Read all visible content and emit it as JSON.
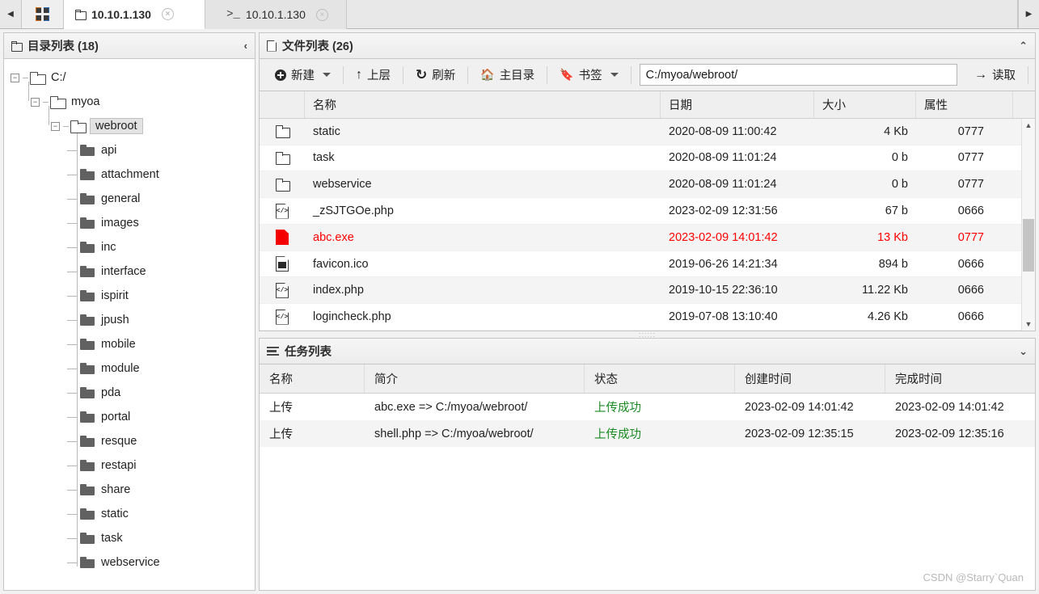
{
  "tabbar": {
    "nav_left_icon": "chevron-left-icon",
    "nav_right_icon": "chevron-right-icon",
    "apps_icon": "grid-apps-icon",
    "tabs": [
      {
        "label": "10.10.1.130",
        "icon": "folder-icon",
        "close": "×",
        "active": true
      },
      {
        "label": "10.10.1.130",
        "icon": "terminal-icon",
        "close": "×",
        "active": false
      }
    ]
  },
  "left_panel": {
    "title": "目录列表 (18)",
    "collapse_icon": "‹",
    "tree": [
      {
        "label": "C:/",
        "depth": 0,
        "expanded": true,
        "selected": false
      },
      {
        "label": "myoa",
        "depth": 1,
        "expanded": true,
        "selected": false
      },
      {
        "label": "webroot",
        "depth": 2,
        "expanded": true,
        "selected": true
      },
      {
        "label": "api",
        "depth": 3,
        "expanded": null,
        "selected": false
      },
      {
        "label": "attachment",
        "depth": 3,
        "expanded": null,
        "selected": false
      },
      {
        "label": "general",
        "depth": 3,
        "expanded": null,
        "selected": false
      },
      {
        "label": "images",
        "depth": 3,
        "expanded": null,
        "selected": false
      },
      {
        "label": "inc",
        "depth": 3,
        "expanded": null,
        "selected": false
      },
      {
        "label": "interface",
        "depth": 3,
        "expanded": null,
        "selected": false
      },
      {
        "label": "ispirit",
        "depth": 3,
        "expanded": null,
        "selected": false
      },
      {
        "label": "jpush",
        "depth": 3,
        "expanded": null,
        "selected": false
      },
      {
        "label": "mobile",
        "depth": 3,
        "expanded": null,
        "selected": false
      },
      {
        "label": "module",
        "depth": 3,
        "expanded": null,
        "selected": false
      },
      {
        "label": "pda",
        "depth": 3,
        "expanded": null,
        "selected": false
      },
      {
        "label": "portal",
        "depth": 3,
        "expanded": null,
        "selected": false
      },
      {
        "label": "resque",
        "depth": 3,
        "expanded": null,
        "selected": false
      },
      {
        "label": "restapi",
        "depth": 3,
        "expanded": null,
        "selected": false
      },
      {
        "label": "share",
        "depth": 3,
        "expanded": null,
        "selected": false
      },
      {
        "label": "static",
        "depth": 3,
        "expanded": null,
        "selected": false
      },
      {
        "label": "task",
        "depth": 3,
        "expanded": null,
        "selected": false
      },
      {
        "label": "webservice",
        "depth": 3,
        "expanded": null,
        "selected": false
      }
    ]
  },
  "file_panel": {
    "title": "文件列表 (26)",
    "collapse_icon": "⌃",
    "toolbar": {
      "new_label": "新建",
      "up_label": "上层",
      "refresh_label": "刷新",
      "home_label": "主目录",
      "bookmark_label": "书签",
      "read_label": "读取",
      "path_value": "C:/myoa/webroot/",
      "path_placeholder": "C:/"
    },
    "columns": [
      "名称",
      "日期",
      "大小",
      "属性"
    ],
    "rows": [
      {
        "icon": "folder-icon",
        "name": "static",
        "date": "2020-08-09 11:00:42",
        "size": "4 Kb",
        "attr": "0777",
        "danger": false
      },
      {
        "icon": "folder-icon",
        "name": "task",
        "date": "2020-08-09 11:01:24",
        "size": "0 b",
        "attr": "0777",
        "danger": false
      },
      {
        "icon": "folder-icon",
        "name": "webservice",
        "date": "2020-08-09 11:01:24",
        "size": "0 b",
        "attr": "0777",
        "danger": false
      },
      {
        "icon": "code-file-icon",
        "name": "_zSJTGOe.php",
        "date": "2023-02-09 12:31:56",
        "size": "67 b",
        "attr": "0666",
        "danger": false
      },
      {
        "icon": "exe-file-icon",
        "name": "abc.exe",
        "date": "2023-02-09 14:01:42",
        "size": "13 Kb",
        "attr": "0777",
        "danger": true
      },
      {
        "icon": "image-file-icon",
        "name": "favicon.ico",
        "date": "2019-06-26 14:21:34",
        "size": "894 b",
        "attr": "0666",
        "danger": false
      },
      {
        "icon": "code-file-icon",
        "name": "index.php",
        "date": "2019-10-15 22:36:10",
        "size": "11.22 Kb",
        "attr": "0666",
        "danger": false
      },
      {
        "icon": "code-file-icon",
        "name": "logincheck.php",
        "date": "2019-07-08 13:10:40",
        "size": "4.26 Kb",
        "attr": "0666",
        "danger": false
      }
    ],
    "scrollbar": {
      "up_arrow": "▲",
      "down_arrow": "▼"
    }
  },
  "task_panel": {
    "title": "任务列表",
    "collapse_icon": "⌄",
    "columns": [
      "名称",
      "简介",
      "状态",
      "创建时间",
      "完成时间"
    ],
    "rows": [
      {
        "name": "上传",
        "desc": "abc.exe => C:/myoa/webroot/",
        "state": "上传成功",
        "ctime": "2023-02-09 14:01:42",
        "ftime": "2023-02-09 14:01:42"
      },
      {
        "name": "上传",
        "desc": "shell.php => C:/myoa/webroot/",
        "state": "上传成功",
        "ctime": "2023-02-09 12:35:15",
        "ftime": "2023-02-09 12:35:16"
      }
    ]
  },
  "watermark": {
    "text": "CSDN @Starry`Quan"
  },
  "colors": {
    "danger": "#ff0000",
    "success": "#1a8a23",
    "panel_bg": "#f0f0f0",
    "border": "#c6c6c6"
  }
}
